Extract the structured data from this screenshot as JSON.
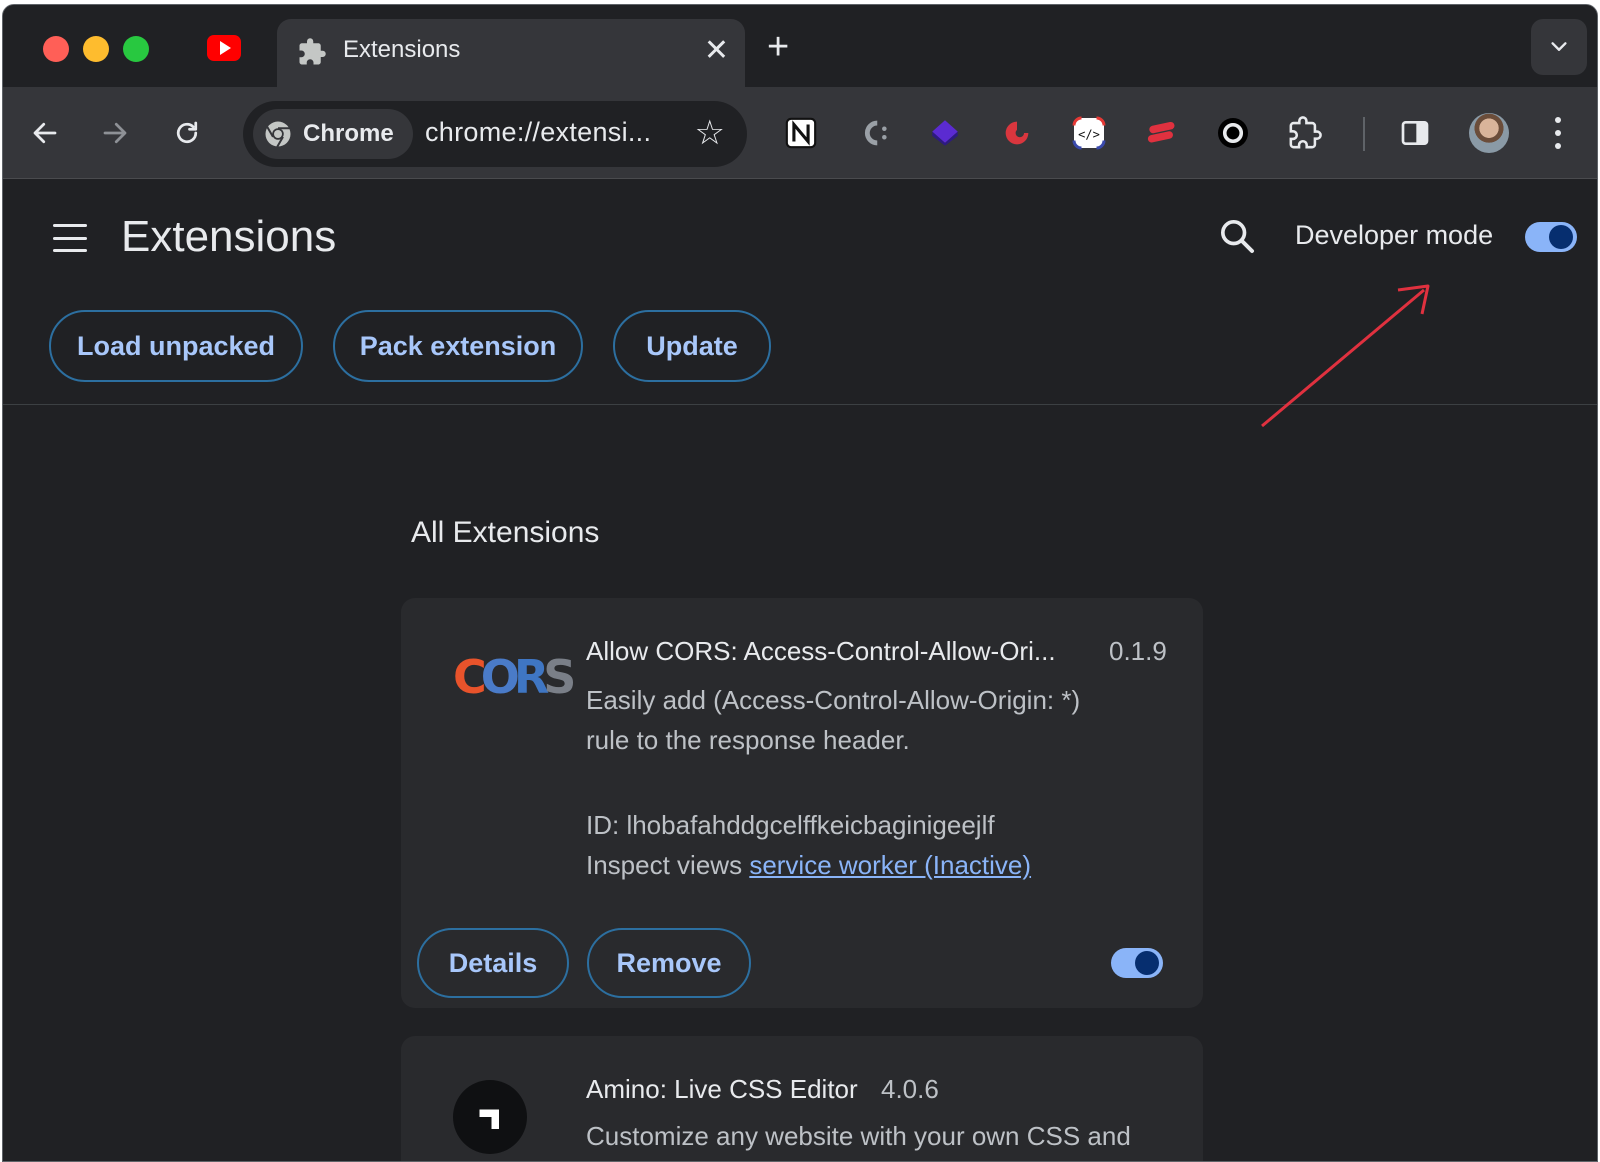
{
  "tab": {
    "title": "Extensions",
    "close": "✕",
    "new_tab": "+"
  },
  "omnibox": {
    "chip_label": "Chrome",
    "url": "chrome://extensi..."
  },
  "toolbar_extensions": [
    "notion-icon",
    "c-icon",
    "layers-icon",
    "eagle-icon",
    "code-icon",
    "stack-icon",
    "circle-icon",
    "puzzle-icon"
  ],
  "page": {
    "title": "Extensions",
    "developer_mode_label": "Developer mode",
    "developer_mode": true,
    "buttons": {
      "load_unpacked": "Load unpacked",
      "pack_extension": "Pack extension",
      "update": "Update"
    },
    "section_title": "All Extensions"
  },
  "extensions": [
    {
      "logo_text": "CORS",
      "name": "Allow CORS: Access-Control-Allow-Ori...",
      "version": "0.1.9",
      "description_line1": "Easily add (Access-Control-Allow-Origin: *)",
      "description_line2": "rule to the response header.",
      "id_line": "ID: lhobafahddgcelffkeicbaginigeejlf",
      "inspect_label": "Inspect views",
      "inspect_link": "service worker (Inactive)",
      "details_label": "Details",
      "remove_label": "Remove",
      "enabled": true
    },
    {
      "name": "Amino: Live CSS Editor",
      "version": "4.0.6",
      "description_line1": "Customize any website with your own CSS and"
    }
  ],
  "colors": {
    "accent": "#8ab4f8",
    "annotation_arrow": "#e0313f",
    "background": "#202124",
    "card": "#292a2d"
  }
}
